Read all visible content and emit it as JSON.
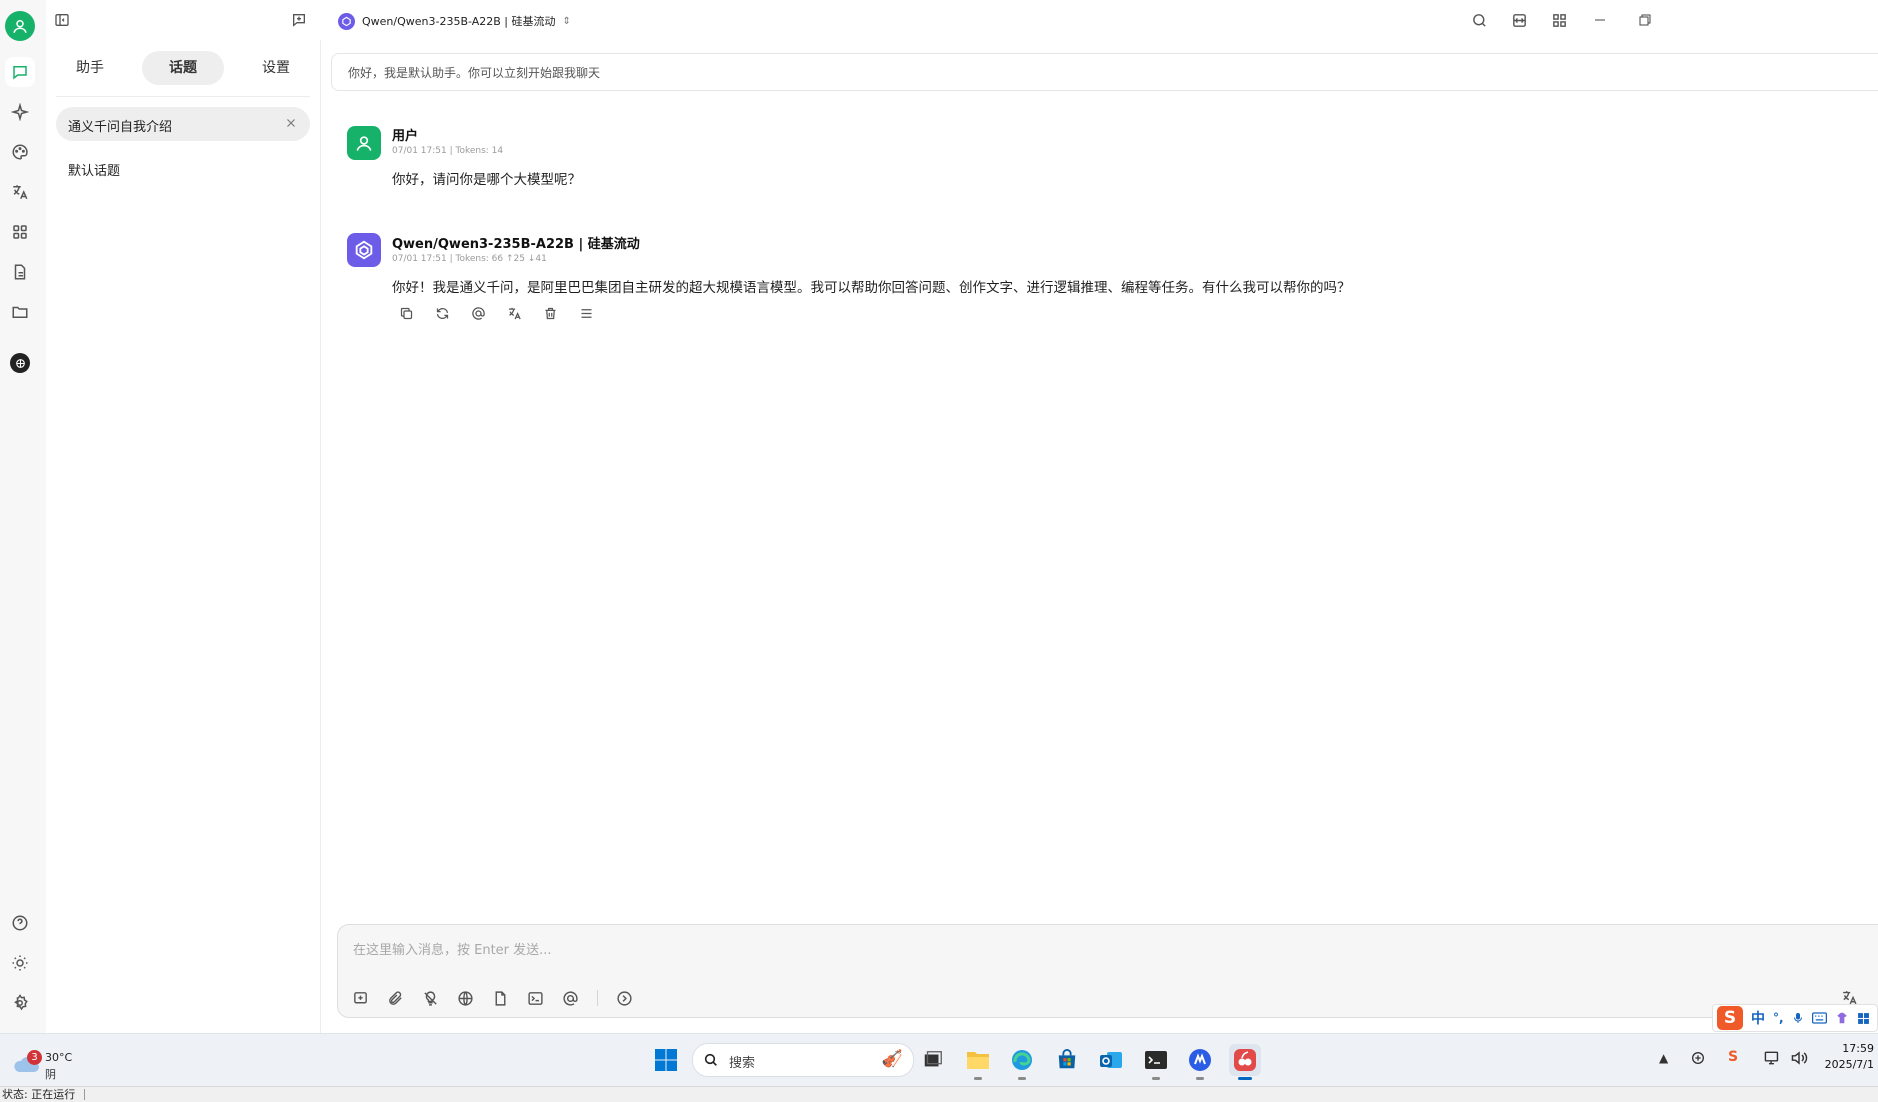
{
  "header": {
    "model_selector": "Qwen/Qwen3-235B-A22B | 硅基流动"
  },
  "topic_panel": {
    "tabs": [
      "助手",
      "话题",
      "设置"
    ],
    "active_topic": "通义千问自我介绍",
    "topics": [
      "默认话题"
    ]
  },
  "chat": {
    "system_prompt": "你好，我是默认助手。你可以立刻开始跟我聊天",
    "messages": [
      {
        "name": "用户",
        "meta": "07/01 17:51  |  Tokens: 14",
        "text": "你好，请问你是哪个大模型呢？"
      },
      {
        "name": "Qwen/Qwen3-235B-A22B | 硅基流动",
        "meta": "07/01 17:51  |  Tokens: 66 ↑25 ↓41",
        "text": "你好！我是通义千问，是阿里巴巴集团自主研发的超大规模语言模型。我可以帮助你回答问题、创作文字、进行逻辑推理、编程等任务。有什么我可以帮你的吗？"
      }
    ],
    "input_placeholder": "在这里输入消息，按 Enter 发送..."
  },
  "taskbar": {
    "weather_badge": "3",
    "temperature": "30°C",
    "condition": "阴",
    "search_placeholder": "搜索",
    "ime_label": "中",
    "time": "17:59",
    "date": "2025/7/1"
  },
  "statusbar": {
    "text": "状态: 正在运行"
  },
  "colors": {
    "accent_green": "#17b26a",
    "model_purple": "#6c5ce7",
    "windows_blue": "#0067c0"
  }
}
